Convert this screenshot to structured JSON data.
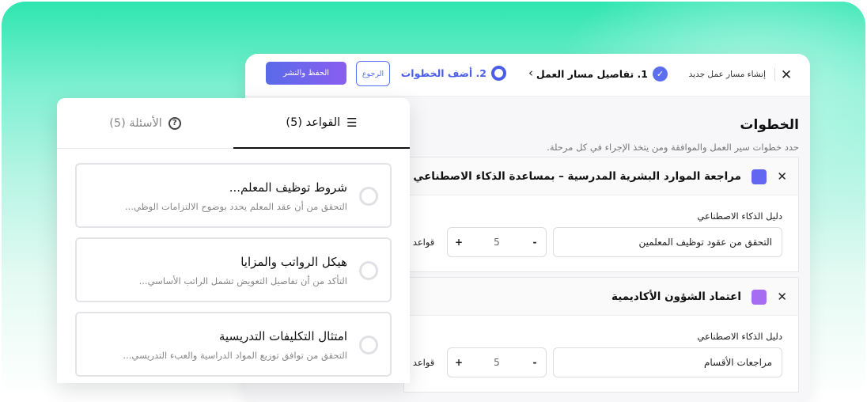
{
  "window": {
    "title": "إنشاء مسار عمل جديد",
    "stepper": {
      "step1_label": "1. تفاصيل مسار العمل",
      "step2_label": "2. أضف الخطوات"
    },
    "back_label": "الرجوع",
    "save_label": "الحفظ والنشر"
  },
  "steps_section": {
    "heading": "الخطوات",
    "subheading": "حدد خطوات سير العمل والموافقة ومن يتخذ الإجراء في كل مرحلة."
  },
  "step_cards": [
    {
      "title": "مراجعة الموارد البشرية المدرسية – بمساعدة الذكاء الاصطناعي",
      "color": "#6366f1",
      "field_label": "دليل الذكاء الاصطناعي",
      "field_value": "التحقق من عقود توظيف المعلمين",
      "count": "5",
      "side_label": "قواعد ذ"
    },
    {
      "title": "اعتماد الشؤون الأكاديمية",
      "color": "#a66cf2",
      "field_label": "دليل الذكاء الاصطناعي",
      "field_value": "مراجعات الأقسام",
      "count": "5",
      "side_label": "قواعد ذ"
    }
  ],
  "panel": {
    "tabs": [
      {
        "label": "القواعد (5)",
        "icon": "checklist-icon",
        "active": true
      },
      {
        "label": "الأسئلة (5)",
        "icon": "question-circle-icon",
        "active": false
      }
    ],
    "rules": [
      {
        "title": "شروط توظيف المعلم...",
        "desc": "التحقق من أن عقد المعلم يحدد بوضوح الالتزامات الوظي..."
      },
      {
        "title": "هيكل الرواتب والمزايا",
        "desc": "التأكد من أن تفاصيل التعويض تشمل الراتب الأساسي..."
      },
      {
        "title": "امتثال التكليفات التدريسية",
        "desc": "التحقق من توافق توزيع المواد الدراسية والعبء التدريسي..."
      }
    ]
  }
}
